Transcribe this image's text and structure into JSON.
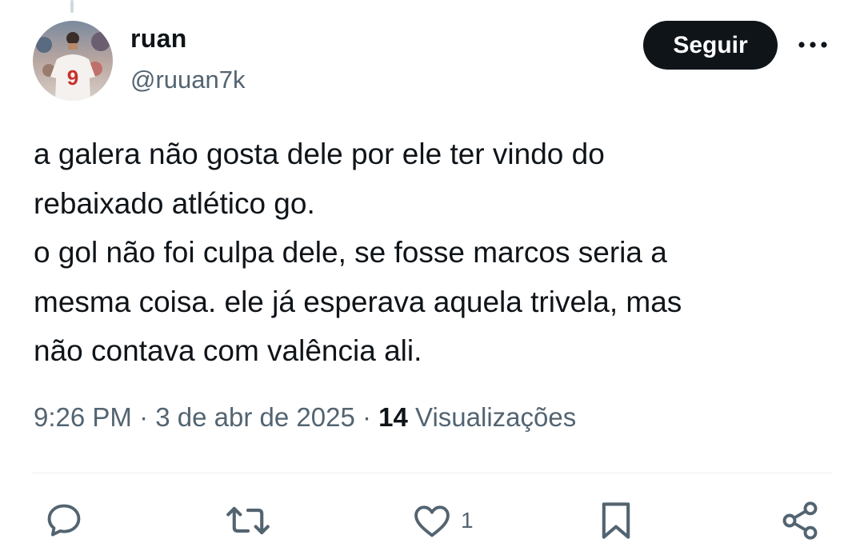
{
  "author": {
    "display_name": "ruan",
    "handle": "@ruuan7k",
    "avatar_icon": "avatar-photo-player-number-9"
  },
  "follow_button_label": "Seguir",
  "more_icon": "more-horizontal-icon",
  "tweet": {
    "text": "a galera não gosta dele por ele ter vindo do\nrebaixado atlético go.\no gol não foi culpa dele, se fosse marcos seria a\nmesma coisa. ele já esperava aquela trivela, mas\nnão contava com valência ali."
  },
  "meta": {
    "time": "9:26 PM",
    "separator": "·",
    "date": "3 de abr de 2025",
    "views_count": "14",
    "views_label": "Visualizações"
  },
  "actions": {
    "reply_icon": "reply-icon",
    "retweet_icon": "retweet-icon",
    "like_icon": "heart-icon",
    "like_count": "1",
    "bookmark_icon": "bookmark-icon",
    "share_icon": "share-icon"
  },
  "colors": {
    "text_primary": "#0f1419",
    "text_secondary": "#536471",
    "follow_button_bg": "#0f1419",
    "divider": "#eff3f4"
  }
}
